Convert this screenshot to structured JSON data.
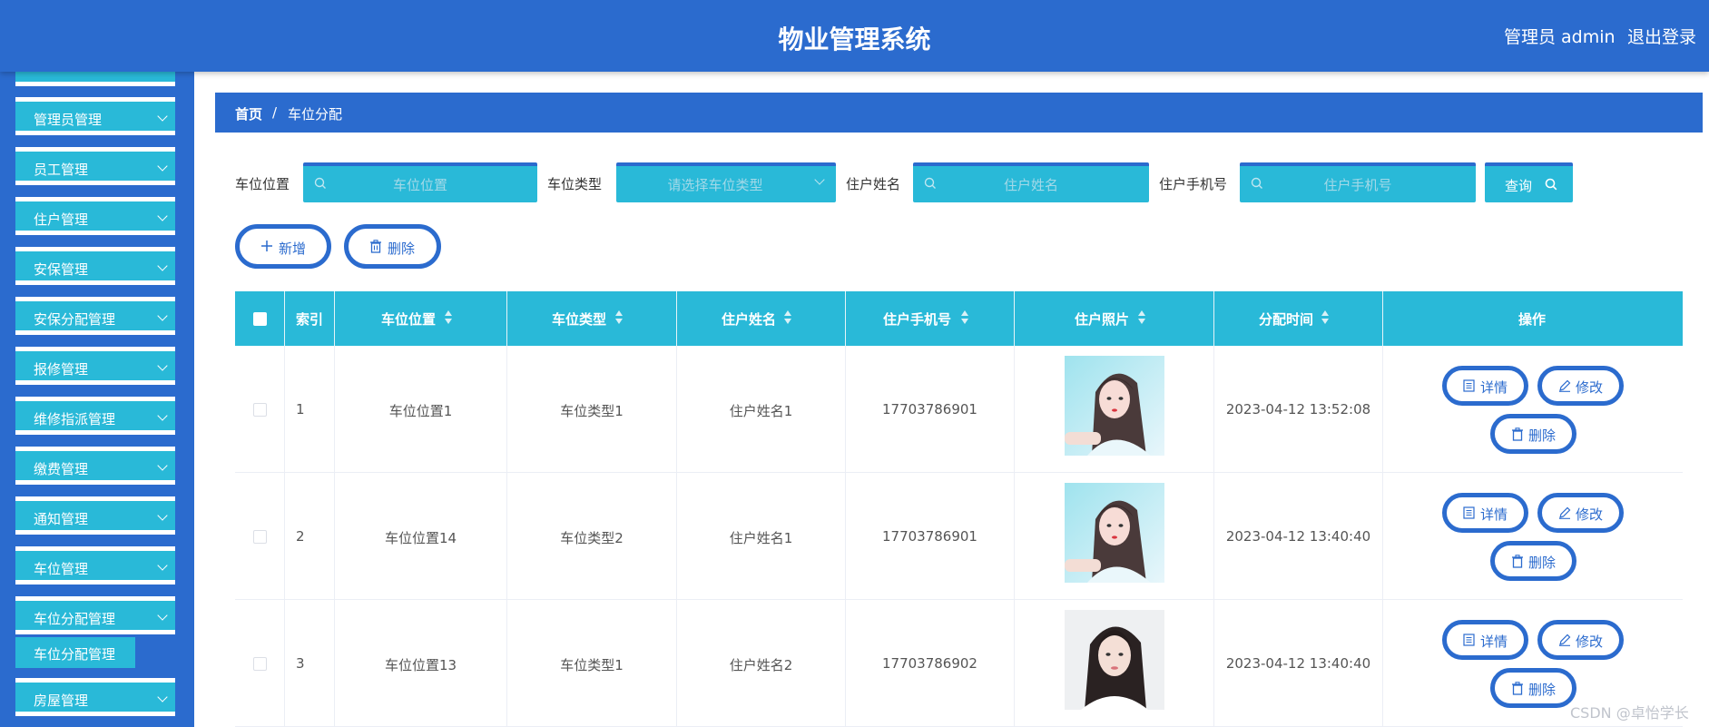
{
  "header": {
    "title": "物业管理系统",
    "user": "管理员 admin",
    "logout": "退出登录"
  },
  "sidebar": {
    "items": [
      {
        "label": "管理员管理"
      },
      {
        "label": "员工管理"
      },
      {
        "label": "住户管理"
      },
      {
        "label": "安保管理"
      },
      {
        "label": "安保分配管理"
      },
      {
        "label": "报修管理"
      },
      {
        "label": "维修指派管理"
      },
      {
        "label": "缴费管理"
      },
      {
        "label": "通知管理"
      },
      {
        "label": "车位管理"
      },
      {
        "label": "车位分配管理"
      },
      {
        "label": "房屋管理"
      }
    ],
    "active_sub": "车位分配管理"
  },
  "breadcrumb": {
    "home": "首页",
    "sep": "/",
    "current": "车位分配"
  },
  "search": {
    "f1_label": "车位位置",
    "f1_placeholder": "车位位置",
    "f2_label": "车位类型",
    "f2_placeholder": "请选择车位类型",
    "f3_label": "住户姓名",
    "f3_placeholder": "住户姓名",
    "f4_label": "住户手机号",
    "f4_placeholder": "住户手机号",
    "query": "查询"
  },
  "actions": {
    "add": "新增",
    "delete": "删除"
  },
  "table": {
    "headers": {
      "index": "索引",
      "location": "车位位置",
      "type": "车位类型",
      "name": "住户姓名",
      "phone": "住户手机号",
      "photo": "住户照片",
      "time": "分配时间",
      "ops": "操作"
    },
    "op_labels": {
      "detail": "详情",
      "edit": "修改",
      "delete": "删除"
    },
    "rows": [
      {
        "index": "1",
        "location": "车位位置1",
        "type": "车位类型1",
        "name": "住户姓名1",
        "phone": "17703786901",
        "time": "2023-04-12 13:52:08"
      },
      {
        "index": "2",
        "location": "车位位置14",
        "type": "车位类型2",
        "name": "住户姓名1",
        "phone": "17703786901",
        "time": "2023-04-12 13:40:40"
      },
      {
        "index": "3",
        "location": "车位位置13",
        "type": "车位类型1",
        "name": "住户姓名2",
        "phone": "17703786902",
        "time": "2023-04-12 13:40:40"
      }
    ]
  },
  "watermark": "CSDN @卓怡学长",
  "colors": {
    "primary": "#2b6bce",
    "accent": "#29b9d8"
  }
}
